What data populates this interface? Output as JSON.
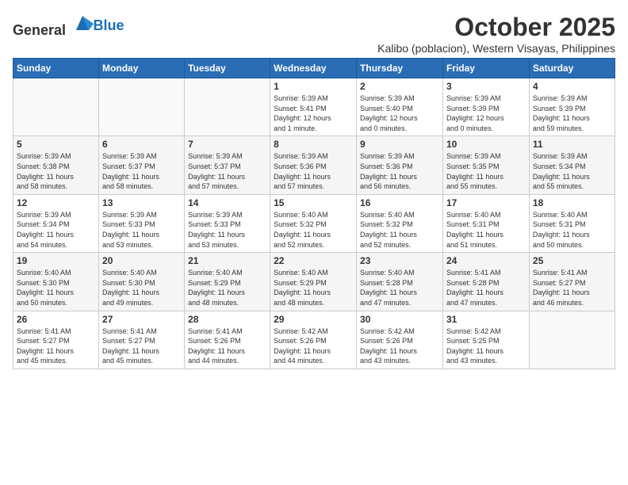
{
  "header": {
    "logo_general": "General",
    "logo_blue": "Blue",
    "month": "October 2025",
    "location": "Kalibo (poblacion), Western Visayas, Philippines"
  },
  "calendar": {
    "days_of_week": [
      "Sunday",
      "Monday",
      "Tuesday",
      "Wednesday",
      "Thursday",
      "Friday",
      "Saturday"
    ],
    "weeks": [
      [
        {
          "day": "",
          "info": ""
        },
        {
          "day": "",
          "info": ""
        },
        {
          "day": "",
          "info": ""
        },
        {
          "day": "1",
          "info": "Sunrise: 5:39 AM\nSunset: 5:41 PM\nDaylight: 12 hours\nand 1 minute."
        },
        {
          "day": "2",
          "info": "Sunrise: 5:39 AM\nSunset: 5:40 PM\nDaylight: 12 hours\nand 0 minutes."
        },
        {
          "day": "3",
          "info": "Sunrise: 5:39 AM\nSunset: 5:39 PM\nDaylight: 12 hours\nand 0 minutes."
        },
        {
          "day": "4",
          "info": "Sunrise: 5:39 AM\nSunset: 5:39 PM\nDaylight: 11 hours\nand 59 minutes."
        }
      ],
      [
        {
          "day": "5",
          "info": "Sunrise: 5:39 AM\nSunset: 5:38 PM\nDaylight: 11 hours\nand 58 minutes."
        },
        {
          "day": "6",
          "info": "Sunrise: 5:39 AM\nSunset: 5:37 PM\nDaylight: 11 hours\nand 58 minutes."
        },
        {
          "day": "7",
          "info": "Sunrise: 5:39 AM\nSunset: 5:37 PM\nDaylight: 11 hours\nand 57 minutes."
        },
        {
          "day": "8",
          "info": "Sunrise: 5:39 AM\nSunset: 5:36 PM\nDaylight: 11 hours\nand 57 minutes."
        },
        {
          "day": "9",
          "info": "Sunrise: 5:39 AM\nSunset: 5:36 PM\nDaylight: 11 hours\nand 56 minutes."
        },
        {
          "day": "10",
          "info": "Sunrise: 5:39 AM\nSunset: 5:35 PM\nDaylight: 11 hours\nand 55 minutes."
        },
        {
          "day": "11",
          "info": "Sunrise: 5:39 AM\nSunset: 5:34 PM\nDaylight: 11 hours\nand 55 minutes."
        }
      ],
      [
        {
          "day": "12",
          "info": "Sunrise: 5:39 AM\nSunset: 5:34 PM\nDaylight: 11 hours\nand 54 minutes."
        },
        {
          "day": "13",
          "info": "Sunrise: 5:39 AM\nSunset: 5:33 PM\nDaylight: 11 hours\nand 53 minutes."
        },
        {
          "day": "14",
          "info": "Sunrise: 5:39 AM\nSunset: 5:33 PM\nDaylight: 11 hours\nand 53 minutes."
        },
        {
          "day": "15",
          "info": "Sunrise: 5:40 AM\nSunset: 5:32 PM\nDaylight: 11 hours\nand 52 minutes."
        },
        {
          "day": "16",
          "info": "Sunrise: 5:40 AM\nSunset: 5:32 PM\nDaylight: 11 hours\nand 52 minutes."
        },
        {
          "day": "17",
          "info": "Sunrise: 5:40 AM\nSunset: 5:31 PM\nDaylight: 11 hours\nand 51 minutes."
        },
        {
          "day": "18",
          "info": "Sunrise: 5:40 AM\nSunset: 5:31 PM\nDaylight: 11 hours\nand 50 minutes."
        }
      ],
      [
        {
          "day": "19",
          "info": "Sunrise: 5:40 AM\nSunset: 5:30 PM\nDaylight: 11 hours\nand 50 minutes."
        },
        {
          "day": "20",
          "info": "Sunrise: 5:40 AM\nSunset: 5:30 PM\nDaylight: 11 hours\nand 49 minutes."
        },
        {
          "day": "21",
          "info": "Sunrise: 5:40 AM\nSunset: 5:29 PM\nDaylight: 11 hours\nand 48 minutes."
        },
        {
          "day": "22",
          "info": "Sunrise: 5:40 AM\nSunset: 5:29 PM\nDaylight: 11 hours\nand 48 minutes."
        },
        {
          "day": "23",
          "info": "Sunrise: 5:40 AM\nSunset: 5:28 PM\nDaylight: 11 hours\nand 47 minutes."
        },
        {
          "day": "24",
          "info": "Sunrise: 5:41 AM\nSunset: 5:28 PM\nDaylight: 11 hours\nand 47 minutes."
        },
        {
          "day": "25",
          "info": "Sunrise: 5:41 AM\nSunset: 5:27 PM\nDaylight: 11 hours\nand 46 minutes."
        }
      ],
      [
        {
          "day": "26",
          "info": "Sunrise: 5:41 AM\nSunset: 5:27 PM\nDaylight: 11 hours\nand 45 minutes."
        },
        {
          "day": "27",
          "info": "Sunrise: 5:41 AM\nSunset: 5:27 PM\nDaylight: 11 hours\nand 45 minutes."
        },
        {
          "day": "28",
          "info": "Sunrise: 5:41 AM\nSunset: 5:26 PM\nDaylight: 11 hours\nand 44 minutes."
        },
        {
          "day": "29",
          "info": "Sunrise: 5:42 AM\nSunset: 5:26 PM\nDaylight: 11 hours\nand 44 minutes."
        },
        {
          "day": "30",
          "info": "Sunrise: 5:42 AM\nSunset: 5:26 PM\nDaylight: 11 hours\nand 43 minutes."
        },
        {
          "day": "31",
          "info": "Sunrise: 5:42 AM\nSunset: 5:25 PM\nDaylight: 11 hours\nand 43 minutes."
        },
        {
          "day": "",
          "info": ""
        }
      ]
    ]
  }
}
